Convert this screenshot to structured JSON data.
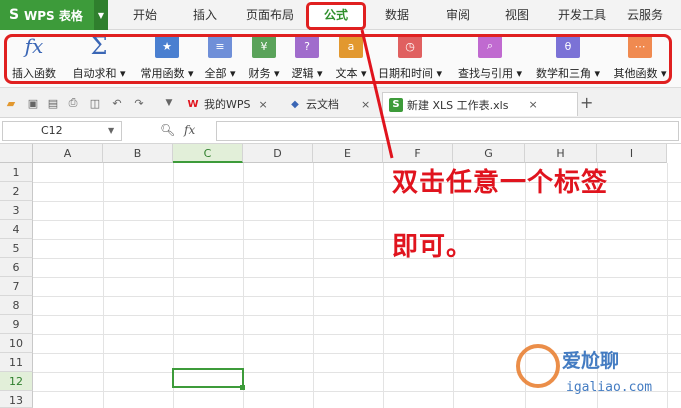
{
  "app": {
    "logo": "S",
    "name": "WPS 表格",
    "brand_color": "#3d9b3a"
  },
  "menu_tabs": [
    {
      "label": "开始"
    },
    {
      "label": "插入"
    },
    {
      "label": "页面布局"
    },
    {
      "label": "公式"
    },
    {
      "label": "数据"
    },
    {
      "label": "审阅"
    },
    {
      "label": "视图"
    },
    {
      "label": "开发工具"
    },
    {
      "label": "云服务"
    }
  ],
  "ribbon": [
    {
      "label": "插入函数",
      "icon": "fx",
      "color": "#3a66b5"
    },
    {
      "label": "自动求和 ▾",
      "icon": "Σ",
      "color": "#3a66b5"
    },
    {
      "label": "常用函数 ▾",
      "icon": "★",
      "color": "#4a7fd0"
    },
    {
      "label": "全部 ▾",
      "icon": "≡",
      "color": "#6f8fd8"
    },
    {
      "label": "财务 ▾",
      "icon": "¥",
      "color": "#5aa35a"
    },
    {
      "label": "逻辑 ▾",
      "icon": "?",
      "color": "#a06ccc"
    },
    {
      "label": "文本 ▾",
      "icon": "a",
      "color": "#e2982f"
    },
    {
      "label": "日期和时间 ▾",
      "icon": "◷",
      "color": "#e06060"
    },
    {
      "label": "查找与引用 ▾",
      "icon": "⌕",
      "color": "#c06ad0"
    },
    {
      "label": "数学和三角 ▾",
      "icon": "θ",
      "color": "#7b72d6"
    },
    {
      "label": "其他函数 ▾",
      "icon": "⋯",
      "color": "#f08a50"
    }
  ],
  "doc_tabs": [
    {
      "label": "我的WPS",
      "close": "×",
      "icon": "W"
    },
    {
      "label": "云文档",
      "close": "×",
      "icon": "◆"
    },
    {
      "label": "新建 XLS 工作表.xls",
      "close": "×",
      "icon": "S"
    }
  ],
  "add_tab": "+",
  "formula_bar": {
    "cell_ref": "C12",
    "fx": "fx",
    "value": ""
  },
  "columns": [
    "A",
    "B",
    "C",
    "D",
    "E",
    "F",
    "G",
    "H",
    "I"
  ],
  "rows": [
    "1",
    "2",
    "3",
    "4",
    "5",
    "6",
    "7",
    "8",
    "9",
    "10",
    "11",
    "12",
    "13"
  ],
  "selected": {
    "column": "C",
    "row": "12"
  },
  "annotation": {
    "line1": "双击任意一个标签",
    "line2": "即可。",
    "color": "#e0141e"
  },
  "watermark": {
    "text1": "爱尬聊",
    "text2": "igaliao.com"
  }
}
